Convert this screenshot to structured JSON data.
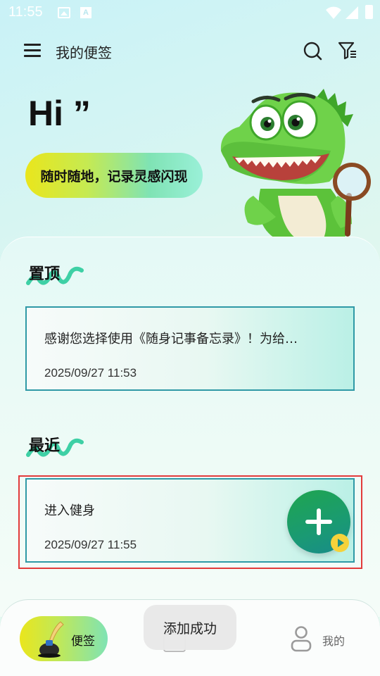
{
  "status_bar": {
    "time": "11:55",
    "a_badge": "A"
  },
  "header": {
    "title": "我的便签"
  },
  "hero": {
    "greeting": "Hi ”",
    "slogan": "随时随地，记录灵感闪现"
  },
  "pinned": {
    "title": "置顶",
    "notes": [
      {
        "text": "感谢您选择使用《随身记事备忘录》！为给…",
        "date": "2025/09/27 11:53"
      }
    ]
  },
  "recent": {
    "title": "最近",
    "notes": [
      {
        "text": "进入健身",
        "date": "2025/09/27 11:55"
      }
    ]
  },
  "bottom_nav": {
    "notes_label": "便签",
    "me_label": "我的"
  },
  "toast": {
    "message": "添加成功"
  },
  "colors": {
    "accent_green": "#1fa54f",
    "card_border": "#2f99a6",
    "highlight_red": "#e23b3b",
    "pill_yellow": "#eae61c"
  }
}
